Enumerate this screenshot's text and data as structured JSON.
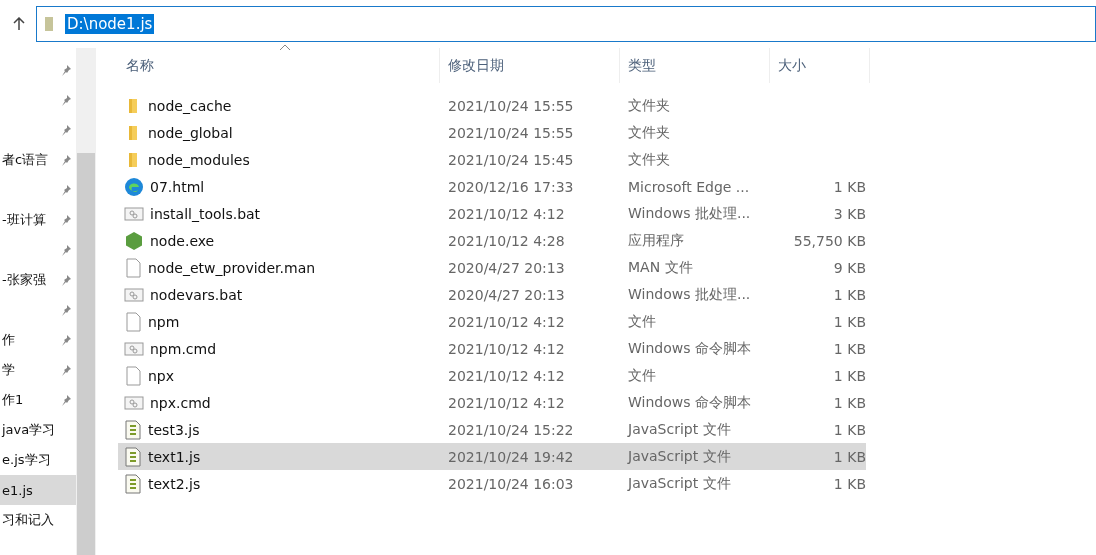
{
  "address_bar": {
    "path": "D:\\node1.js",
    "selected": true
  },
  "sidebar": {
    "items": [
      {
        "pinned": true,
        "selected": false
      },
      {
        "pinned": true,
        "selected": false
      },
      {
        "pinned": true,
        "selected": false
      },
      {
        "label": "者c语言",
        "pinned": true,
        "selected": false
      },
      {
        "pinned": true,
        "selected": false
      },
      {
        "label": "-班计算",
        "pinned": true,
        "selected": false
      },
      {
        "pinned": true,
        "selected": false
      },
      {
        "label": "-张家强",
        "pinned": true,
        "selected": false
      },
      {
        "pinned": true,
        "selected": false
      },
      {
        "label": "作",
        "pinned": true,
        "selected": false
      },
      {
        "label": "学",
        "pinned": true,
        "selected": false
      },
      {
        "label": "作1",
        "pinned": true,
        "selected": false
      },
      {
        "label": "java学习",
        "pinned": false,
        "selected": false
      },
      {
        "label": "e.js学习",
        "pinned": false,
        "selected": false
      },
      {
        "label": "e1.js",
        "pinned": false,
        "selected": true
      },
      {
        "label": "习和记入",
        "pinned": false,
        "selected": false
      }
    ]
  },
  "table": {
    "columns": [
      {
        "label": "名称",
        "sorted": true
      },
      {
        "label": "修改日期",
        "sorted": false
      },
      {
        "label": "类型",
        "sorted": false
      },
      {
        "label": "大小",
        "sorted": false
      }
    ],
    "rows": [
      {
        "kind": "folder",
        "name": "node_cache",
        "modified": "2021/10/24 15:55",
        "type": "文件夹",
        "selected": false
      },
      {
        "kind": "folder",
        "name": "node_global",
        "modified": "2021/10/24 15:55",
        "type": "文件夹",
        "selected": false
      },
      {
        "kind": "folder",
        "name": "node_modules",
        "modified": "2021/10/24 15:45",
        "type": "文件夹",
        "selected": false
      },
      {
        "kind": "edge",
        "name": "07.html",
        "modified": "2020/12/16 17:33",
        "type": "Microsoft Edge ...",
        "size": "1 KB",
        "selected": false
      },
      {
        "kind": "batch",
        "name": "install_tools.bat",
        "modified": "2021/10/12 4:12",
        "type": "Windows 批处理...",
        "size": "3 KB",
        "selected": false
      },
      {
        "kind": "node",
        "name": "node.exe",
        "modified": "2021/10/12 4:28",
        "type": "应用程序",
        "size": "55,750 KB",
        "selected": false
      },
      {
        "kind": "file",
        "name": "node_etw_provider.man",
        "modified": "2020/4/27 20:13",
        "type": "MAN 文件",
        "size": "9 KB",
        "selected": false
      },
      {
        "kind": "batch",
        "name": "nodevars.bat",
        "modified": "2020/4/27 20:13",
        "type": "Windows 批处理...",
        "size": "1 KB",
        "selected": false
      },
      {
        "kind": "file",
        "name": "npm",
        "modified": "2021/10/12 4:12",
        "type": "文件",
        "size": "1 KB",
        "selected": false
      },
      {
        "kind": "batch",
        "name": "npm.cmd",
        "modified": "2021/10/12 4:12",
        "type": "Windows 命令脚本",
        "size": "1 KB",
        "selected": false
      },
      {
        "kind": "file",
        "name": "npx",
        "modified": "2021/10/12 4:12",
        "type": "文件",
        "size": "1 KB",
        "selected": false
      },
      {
        "kind": "batch",
        "name": "npx.cmd",
        "modified": "2021/10/12 4:12",
        "type": "Windows 命令脚本",
        "size": "1 KB",
        "selected": false
      },
      {
        "kind": "script",
        "name": "test3.js",
        "modified": "2021/10/24 15:22",
        "type": "JavaScript 文件",
        "size": "1 KB",
        "selected": false
      },
      {
        "kind": "script",
        "name": "text1.js",
        "modified": "2021/10/24 19:42",
        "type": "JavaScript 文件",
        "size": "1 KB",
        "selected": true
      },
      {
        "kind": "script",
        "name": "text2.js",
        "modified": "2021/10/24 16:03",
        "type": "JavaScript 文件",
        "size": "1 KB",
        "selected": false
      }
    ]
  }
}
